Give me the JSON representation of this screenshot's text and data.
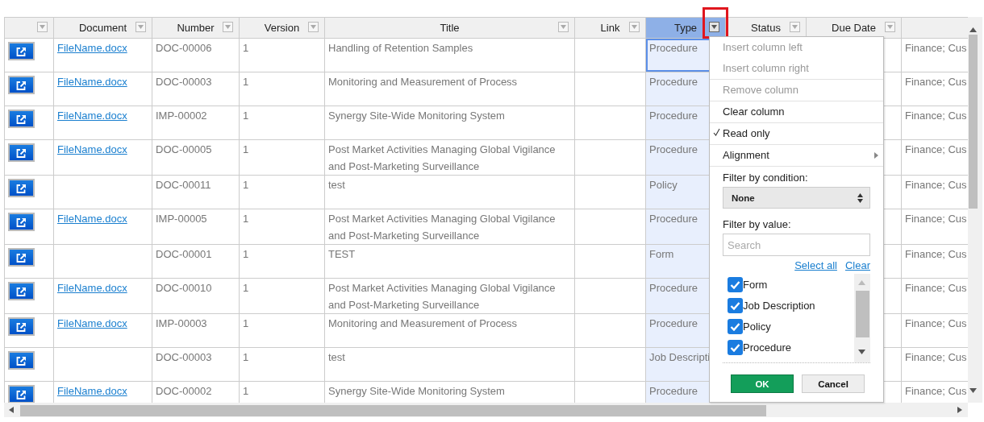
{
  "table": {
    "columns": [
      {
        "selected": false
      },
      {
        "label": "Document",
        "selected": false
      },
      {
        "label": "Number",
        "selected": false
      },
      {
        "label": "Version",
        "selected": false
      },
      {
        "label": "Title",
        "selected": false
      },
      {
        "label": "Link",
        "selected": false
      },
      {
        "label": "Type",
        "selected": true
      },
      {
        "label": "Status",
        "selected": false
      },
      {
        "label": "Due Date",
        "selected": false
      },
      {
        "selected": false
      }
    ],
    "rows": [
      {
        "document": "FileName.docx",
        "number": "DOC-00006",
        "version": "1",
        "title": "Handling of Retention Samples",
        "type": "Procedure",
        "type_focused": true,
        "column_10": "Finance; Cus"
      },
      {
        "document": "FileName.docx",
        "number": "DOC-00003",
        "version": "1",
        "title": "Monitoring and Measurement of Process",
        "type": "Procedure",
        "type_focused": false,
        "column_10": "Finance; Cus"
      },
      {
        "document": "FileName.docx",
        "number": "IMP-00002",
        "version": "1",
        "title": "Synergy Site-Wide Monitoring System",
        "type": "Procedure",
        "type_focused": false,
        "column_10": "Finance; Cus"
      },
      {
        "document": "FileName.docx",
        "number": "DOC-00005",
        "version": "1",
        "title": "Post Market Activities Managing Global Vigilance and Post-Marketing Surveillance",
        "type": "Procedure",
        "type_focused": false,
        "column_10": "Finance; Cus"
      },
      {
        "number": "DOC-00011",
        "version": "1",
        "title": "test",
        "type": "Policy",
        "type_focused": false,
        "column_10": "Finance; Cus"
      },
      {
        "document": "FileName.docx",
        "number": "IMP-00005",
        "version": "1",
        "title": "Post Market Activities Managing Global Vigilance and Post-Marketing Surveillance",
        "type": "Procedure",
        "type_focused": false,
        "column_10": "Finance; Cus"
      },
      {
        "number": "DOC-00001",
        "version": "1",
        "title": "TEST",
        "type": "Form",
        "type_focused": false,
        "column_10": "Finance; Cus"
      },
      {
        "document": "FileName.docx",
        "number": "DOC-00010",
        "version": "1",
        "title": "Post Market Activities Managing Global Vigilance and Post-Marketing Surveillance",
        "type": "Procedure",
        "type_focused": false,
        "column_10": "Finance; Cus"
      },
      {
        "document": "FileName.docx",
        "number": "IMP-00003",
        "version": "1",
        "title": "Monitoring and Measurement of Process",
        "type": "Procedure",
        "type_focused": false,
        "column_10": "Finance; Cus"
      },
      {
        "number": "DOC-00003",
        "version": "1",
        "title": "test",
        "type": "Job Descripti",
        "type_focused": false,
        "column_10": "Finance; Cus"
      },
      {
        "document": "FileName.docx",
        "number": "DOC-00002",
        "version": "1",
        "title": "Synergy Site-Wide Monitoring System",
        "type": "Procedure",
        "type_focused": false,
        "column_10": "Finance; Cus"
      }
    ]
  },
  "column_menu": {
    "items": [
      {
        "kind": "item",
        "label": "Insert column left",
        "disabled": true,
        "checked": false
      },
      {
        "kind": "item",
        "label": "Insert column right",
        "disabled": true,
        "checked": false
      },
      {
        "kind": "item",
        "label": "Remove column",
        "disabled": true,
        "checked": false
      },
      {
        "kind": "item",
        "label": "Clear column",
        "disabled": false,
        "checked": false
      },
      {
        "kind": "item",
        "label": "Read only",
        "disabled": false,
        "checked": true
      },
      {
        "kind": "submenu",
        "label": "Alignment",
        "disabled": false,
        "checked": false
      }
    ],
    "filter_by_condition": {
      "label": "Filter by condition:",
      "value": "None"
    },
    "filter_by_value": {
      "label": "Filter by value:",
      "placeholder": "Search",
      "select_all": "Select all",
      "clear": "Clear",
      "values": [
        {
          "label": "Form",
          "checked": true
        },
        {
          "label": "Job Description",
          "checked": true
        },
        {
          "label": "Policy",
          "checked": true
        },
        {
          "label": "Procedure",
          "checked": true
        }
      ]
    },
    "buttons": [
      {
        "kind": "primary",
        "label": "OK"
      },
      {
        "kind": "secondary",
        "label": "Cancel"
      }
    ]
  }
}
